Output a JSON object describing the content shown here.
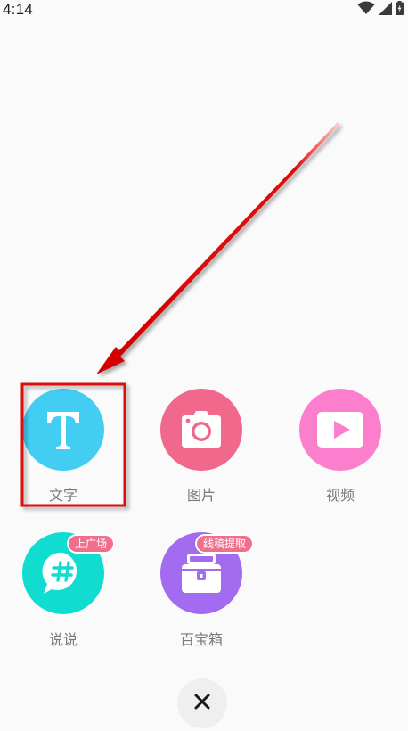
{
  "status_bar": {
    "time": "4:14",
    "icons": [
      "wifi-icon",
      "signal-icon",
      "battery-icon"
    ]
  },
  "menu": {
    "items": [
      {
        "label": "文字",
        "icon": "text-t-icon",
        "color": "#42cdf3"
      },
      {
        "label": "图片",
        "icon": "camera-icon",
        "color": "#f0698d"
      },
      {
        "label": "视频",
        "icon": "video-play-icon",
        "color": "#fb7fcd"
      },
      {
        "label": "说说",
        "icon": "hashtag-chat-icon",
        "color": "#10dcd0",
        "badge": "上广场"
      },
      {
        "label": "百宝箱",
        "icon": "treasure-box-icon",
        "color": "#a36cf0",
        "badge": "线稿提取"
      }
    ]
  },
  "close_button": {
    "icon": "close-icon"
  },
  "annotation": {
    "color": "#e01010"
  }
}
